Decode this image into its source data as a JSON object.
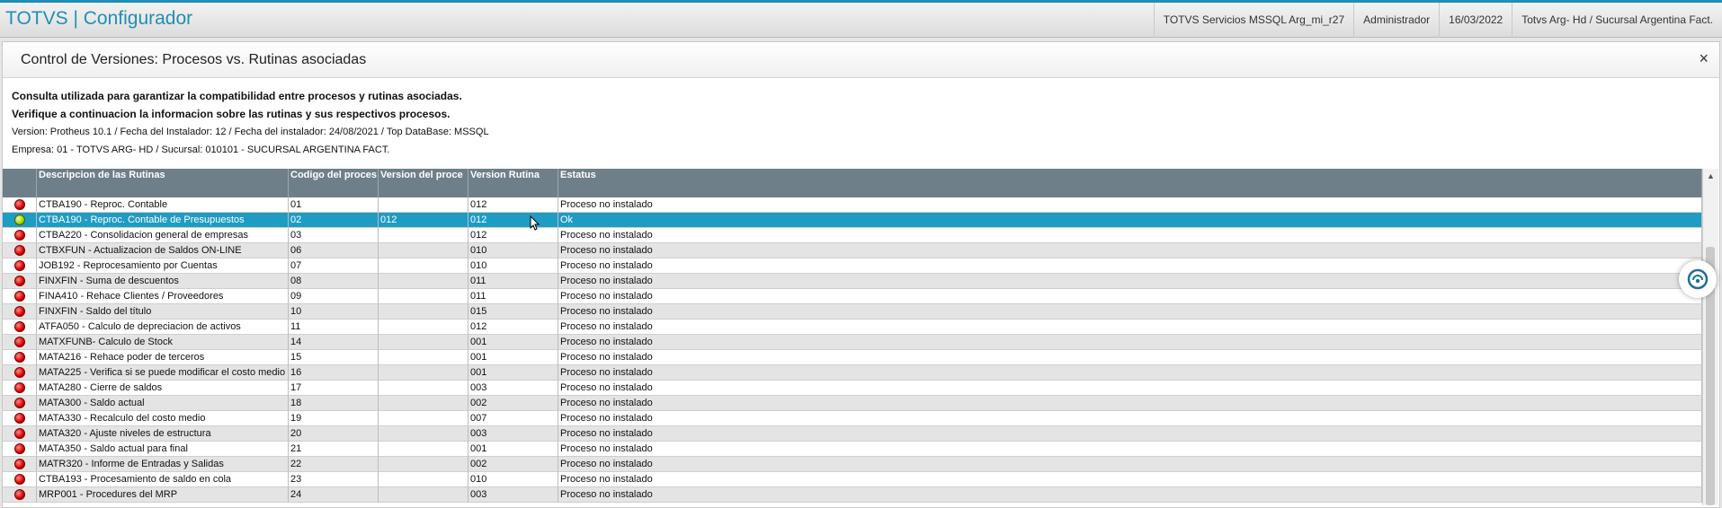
{
  "header": {
    "app_title": "TOTVS | Configurador",
    "server": "TOTVS Servicios MSSQL Arg_mi_r27",
    "user": "Administrador",
    "date": "16/03/2022",
    "branch": "Totvs Arg- Hd / Sucursal Argentina Fact."
  },
  "dialog": {
    "title": "Control de Versiones: Procesos vs. Rutinas asociadas",
    "close_label": "×",
    "info_line1": "Consulta utilizada para garantizar la compatibilidad entre procesos y rutinas asociadas.",
    "info_line2": "Verifique a continuacion la informacion sobre las rutinas y sus respectivos procesos.",
    "info_line3": "Version: Protheus 10.1 / Fecha del Instalador: 12 / Fecha del instalador: 24/08/2021 / Top DataBase: MSSQL",
    "info_line4": "Empresa: 01 - TOTVS ARG- HD / Sucursal: 010101 - SUCURSAL ARGENTINA FACT."
  },
  "grid": {
    "columns": [
      "",
      "Descripcion de las Rutinas",
      "Codigo del proces",
      "Version del proce",
      "Version Rutina",
      "Estatus"
    ],
    "rows": [
      {
        "status": "red",
        "desc": "CTBA190 - Reproc. Contable",
        "code": "01",
        "pver": "",
        "rver": "012",
        "estatus": "Proceso no instalado"
      },
      {
        "status": "green",
        "desc": "CTBA190 - Reproc. Contable de Presupuestos",
        "code": "02",
        "pver": "012",
        "rver": "012",
        "estatus": "Ok"
      },
      {
        "status": "red",
        "desc": "CTBA220 - Consolidacion general de empresas",
        "code": "03",
        "pver": "",
        "rver": "012",
        "estatus": "Proceso no instalado"
      },
      {
        "status": "red",
        "desc": "CTBXFUN - Actualizacion de Saldos ON-LINE",
        "code": "06",
        "pver": "",
        "rver": "010",
        "estatus": "Proceso no instalado"
      },
      {
        "status": "red",
        "desc": "JOB192 - Reprocesamiento por Cuentas",
        "code": "07",
        "pver": "",
        "rver": "010",
        "estatus": "Proceso no instalado"
      },
      {
        "status": "red",
        "desc": "FINXFIN - Suma de descuentos",
        "code": "08",
        "pver": "",
        "rver": "011",
        "estatus": "Proceso no instalado"
      },
      {
        "status": "red",
        "desc": "FINA410 - Rehace Clientes / Proveedores",
        "code": "09",
        "pver": "",
        "rver": "011",
        "estatus": "Proceso no instalado"
      },
      {
        "status": "red",
        "desc": "FINXFIN - Saldo del título",
        "code": "10",
        "pver": "",
        "rver": "015",
        "estatus": "Proceso no instalado"
      },
      {
        "status": "red",
        "desc": "ATFA050 - Calculo de depreciacion de activos",
        "code": "11",
        "pver": "",
        "rver": "012",
        "estatus": "Proceso no instalado"
      },
      {
        "status": "red",
        "desc": "MATXFUNB- Calculo de Stock",
        "code": "14",
        "pver": "",
        "rver": "001",
        "estatus": "Proceso no instalado"
      },
      {
        "status": "red",
        "desc": "MATA216 - Rehace poder de terceros",
        "code": "15",
        "pver": "",
        "rver": "001",
        "estatus": "Proceso no instalado"
      },
      {
        "status": "red",
        "desc": "MATA225 - Verifica si se puede modificar el costo medio (",
        "code": "16",
        "pver": "",
        "rver": "001",
        "estatus": "Proceso no instalado"
      },
      {
        "status": "red",
        "desc": "MATA280 - Cierre de saldos",
        "code": "17",
        "pver": "",
        "rver": "003",
        "estatus": "Proceso no instalado"
      },
      {
        "status": "red",
        "desc": "MATA300 - Saldo actual",
        "code": "18",
        "pver": "",
        "rver": "002",
        "estatus": "Proceso no instalado"
      },
      {
        "status": "red",
        "desc": "MATA330 - Recalculo del costo medio",
        "code": "19",
        "pver": "",
        "rver": "007",
        "estatus": "Proceso no instalado"
      },
      {
        "status": "red",
        "desc": "MATA320 - Ajuste niveles de estructura",
        "code": "20",
        "pver": "",
        "rver": "003",
        "estatus": "Proceso no instalado"
      },
      {
        "status": "red",
        "desc": "MATA350 - Saldo actual para final",
        "code": "21",
        "pver": "",
        "rver": "001",
        "estatus": "Proceso no instalado"
      },
      {
        "status": "red",
        "desc": "MATR320 - Informe de Entradas y Salidas",
        "code": "22",
        "pver": "",
        "rver": "002",
        "estatus": "Proceso no instalado"
      },
      {
        "status": "red",
        "desc": "CTBA193 - Procesamiento de saldo en cola",
        "code": "23",
        "pver": "",
        "rver": "010",
        "estatus": "Proceso no instalado"
      },
      {
        "status": "red",
        "desc": "MRP001 - Procedures del MRP",
        "code": "24",
        "pver": "",
        "rver": "003",
        "estatus": "Proceso no instalado"
      }
    ],
    "selected_index": 1
  },
  "colors": {
    "accent": "#1f8fb5",
    "header_bg": "#6f7f8a",
    "selected_row": "#1e9cc4"
  },
  "icons": {
    "status_error": "red-led-icon",
    "status_ok": "green-led-icon",
    "assistant": "chat-assistant-icon",
    "close": "close-icon"
  }
}
